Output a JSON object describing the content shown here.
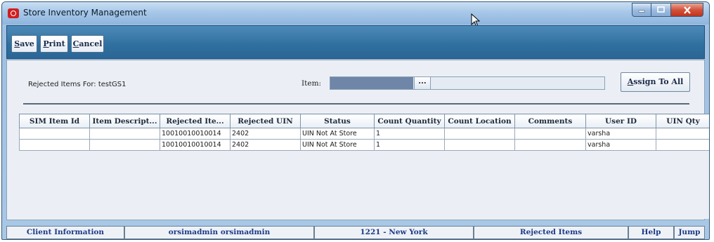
{
  "window": {
    "title": "Store Inventory Management"
  },
  "toolbar": {
    "save_first": "S",
    "save_rest": "ave",
    "print_first": "P",
    "print_rest": "rint",
    "cancel_first": "C",
    "cancel_rest": "ancel"
  },
  "header": {
    "rejected_label": "Rejected Items For:",
    "rejected_value": "testGS1",
    "item_label": "Item:",
    "item_value": "",
    "lookup_label": "...",
    "assign_first": "A",
    "assign_rest": "ssign To All"
  },
  "grid": {
    "columns": [
      "SIM Item Id",
      "Item Descript...",
      "Rejected Ite...",
      "Rejected UIN",
      "Status",
      "Count Quantity",
      "Count Location",
      "Comments",
      "User ID",
      "UIN Qty"
    ],
    "rows": [
      [
        "",
        "",
        "10010010010014",
        "2402",
        "UIN Not At Store",
        "1",
        "",
        "",
        "varsha",
        ""
      ],
      [
        "",
        "",
        "10010010010014",
        "2402",
        "UIN Not At Store",
        "1",
        "",
        "",
        "varsha",
        ""
      ]
    ]
  },
  "statusbar": {
    "client_info": "Client Information",
    "user": "orsimadmin orsimadmin",
    "store": "1221 - New York",
    "screen": "Rejected Items",
    "help": "Help",
    "jump": "Jump"
  },
  "colors": {
    "toolbar_bg": "#2f6f9f",
    "status_text": "#1c3a86",
    "close_button": "#c2331b"
  }
}
